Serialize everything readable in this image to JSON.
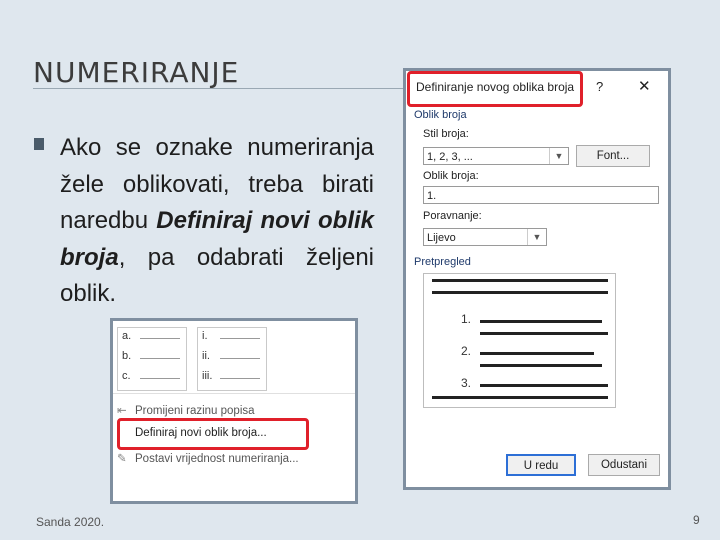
{
  "slide": {
    "title": "NUMERIRANJE",
    "body_plain_1": "Ako se oznake numeriranja žele oblikovati, treba birati naredbu ",
    "body_emph": "Definiraj novi oblik broja",
    "body_plain_2": ", pa odabrati željeni oblik.",
    "footer_author": "Sanda 2020.",
    "page_number": "9"
  },
  "menu": {
    "box1_rows": [
      "a.",
      "b.",
      "c."
    ],
    "box2_rows": [
      "i.",
      "ii.",
      "iii."
    ],
    "items": [
      {
        "icon": "indent-icon",
        "label": "Promijeni razinu popisa"
      },
      {
        "icon": "none",
        "label": "Definiraj novi oblik broja..."
      },
      {
        "icon": "pencil-icon",
        "label": "Postavi vrijednost numeriranja..."
      }
    ]
  },
  "dialog": {
    "title": "Definiranje novog oblika broja",
    "help": "?",
    "close": "✕",
    "section_format": "Oblik broja",
    "style_label": "Stil broja:",
    "style_value": "1, 2, 3, ...",
    "font_button": "Font...",
    "format_label": "Oblik broja:",
    "format_value": "1.",
    "align_label": "Poravnanje:",
    "align_value": "Lijevo",
    "section_preview": "Pretpregled",
    "preview_numbers": [
      "1.",
      "2.",
      "3."
    ],
    "ok_button": "U redu",
    "cancel_button": "Odustani"
  },
  "colors": {
    "highlight": "#e0202a",
    "background": "#dfe7ee",
    "frame": "#7f8fa0"
  }
}
